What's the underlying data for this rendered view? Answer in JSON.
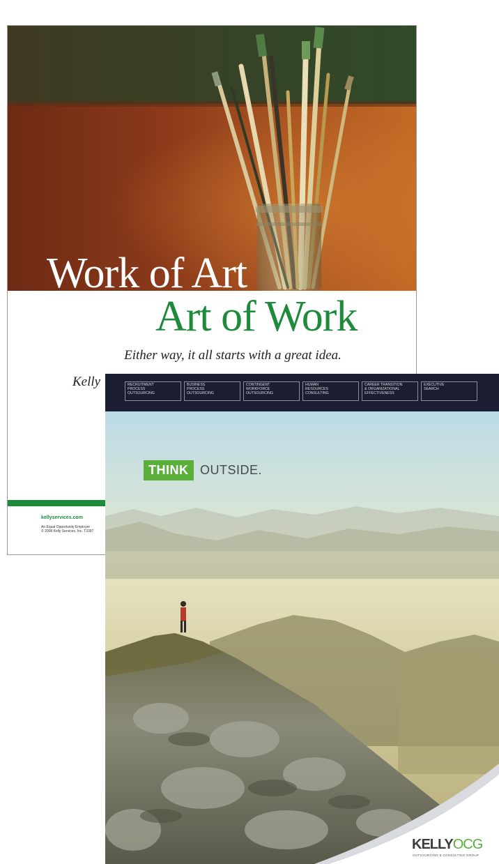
{
  "poster_art": {
    "title_line1": "Work of Art",
    "title_line2": "Art of Work",
    "tagline": "Either way, it all starts with a great idea.",
    "byline_partial": "Kelly",
    "url": "kellyservices.com",
    "legal_line1": "An Equal Opportunity Employer",
    "legal_line2": "© 2008 Kelly Services, Inc. T3397",
    "colors": {
      "green": "#1e8a3c",
      "title_white": "#ffffff"
    }
  },
  "poster_outside": {
    "services": [
      "Recruitment\nProcess\nOutsourcing",
      "Business\nProcess\nOutsourcing",
      "Contingent\nWorkforce\nOutsourcing",
      "Human\nResources\nConsulting",
      "Career Transition\n& Organizational\nEffectiveness",
      "Executive\nSearch"
    ],
    "headline_highlight": "THINK",
    "headline_rest": "OUTSIDE.",
    "logo_main": "KELLY",
    "logo_accent": "OCG",
    "logo_sub": "Outsourcing & Consulting Group",
    "colors": {
      "green": "#5aae3a",
      "nav_bg": "#1b1e30"
    }
  }
}
